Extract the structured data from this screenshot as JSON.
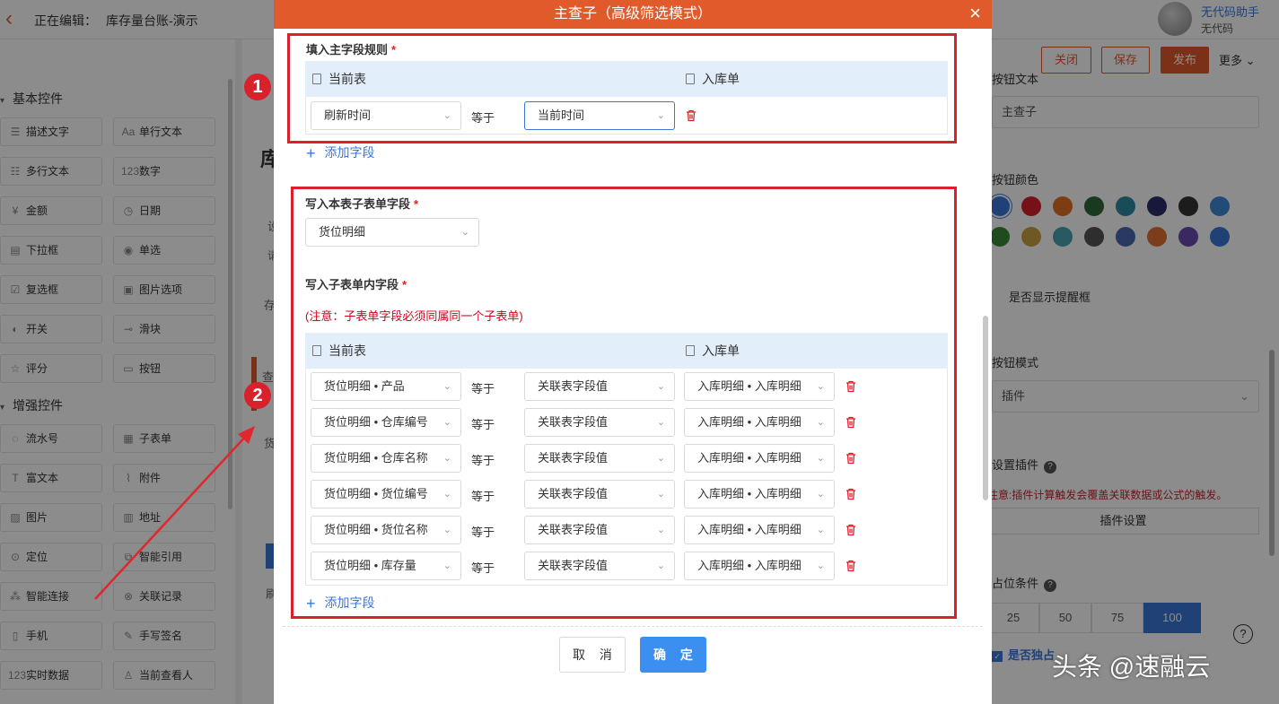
{
  "topbar": {
    "editing_label": "正在编辑：",
    "doc_name": "库存量台账-演示",
    "user_name": "无代码助手",
    "user_sub": "无代码"
  },
  "left_panel": {
    "basic_group": "基本控件",
    "enhanced_group": "增强控件",
    "basic_controls": [
      {
        "label": "描述文字",
        "icon": "text-lines-icon"
      },
      {
        "label": "单行文本",
        "icon": "font-aa-icon"
      },
      {
        "label": "多行文本",
        "icon": "multiline-icon"
      },
      {
        "label": "数字",
        "icon": "number-123-icon"
      },
      {
        "label": "金额",
        "icon": "money-icon"
      },
      {
        "label": "日期",
        "icon": "clock-icon"
      },
      {
        "label": "下拉框",
        "icon": "dropdown-icon"
      },
      {
        "label": "单选",
        "icon": "radio-icon"
      },
      {
        "label": "复选框",
        "icon": "checkbox-icon"
      },
      {
        "label": "图片选项",
        "icon": "image-option-icon"
      },
      {
        "label": "开关",
        "icon": "toggle-icon"
      },
      {
        "label": "滑块",
        "icon": "slider-icon"
      },
      {
        "label": "评分",
        "icon": "star-icon"
      },
      {
        "label": "按钮",
        "icon": "button-icon"
      }
    ],
    "enhanced_controls": [
      {
        "label": "流水号",
        "icon": "serial-icon"
      },
      {
        "label": "子表单",
        "icon": "subform-icon"
      },
      {
        "label": "富文本",
        "icon": "richtext-icon"
      },
      {
        "label": "附件",
        "icon": "paperclip-icon"
      },
      {
        "label": "图片",
        "icon": "image-icon"
      },
      {
        "label": "地址",
        "icon": "map-icon"
      },
      {
        "label": "定位",
        "icon": "location-pin-icon"
      },
      {
        "label": "智能引用",
        "icon": "smart-ref-icon"
      },
      {
        "label": "智能连接",
        "icon": "connect-icon"
      },
      {
        "label": "关联记录",
        "icon": "link-record-icon"
      },
      {
        "label": "手机",
        "icon": "phone-icon"
      },
      {
        "label": "手写签名",
        "icon": "signature-icon"
      },
      {
        "label": "实时数据",
        "icon": "realtime-icon"
      },
      {
        "label": "当前查看人",
        "icon": "viewer-icon"
      }
    ]
  },
  "canvas": {
    "title_char": "库",
    "frag1": "设",
    "frag2": "请",
    "frag3": "存",
    "frag4": "查",
    "frag5": "货",
    "frag6": "刷"
  },
  "right_panel": {
    "btn_close": "关闭",
    "btn_save": "保存",
    "btn_publish": "发布",
    "more": "更多",
    "button_text_label": "按钮文本",
    "button_text_value": "主查子",
    "button_color_label": "按钮颜色",
    "swatch_colors": [
      "#3b77d8",
      "#d8212b",
      "#e07020",
      "#2e6b3a",
      "#2a8aa0",
      "#2c2c6a",
      "#333333",
      "#3b8ad8",
      "#3a8a3a",
      "#c8a040",
      "#4aa0b0",
      "#555555",
      "#4a6ab0",
      "#e07030",
      "#6a4ab0",
      "#3b77d8"
    ],
    "show_reminder": "是否显示提醒框",
    "button_mode_label": "按钮模式",
    "button_mode_value": "插件",
    "plugin_label": "设置插件",
    "plugin_note": "注意:插件计算触发会覆盖关联数据或公式的触发。",
    "plugin_btn": "插件设置",
    "width_label": "占位条件",
    "pct_options": [
      "25",
      "50",
      "75",
      "100"
    ],
    "pct_active": "100",
    "independent": "是否独占",
    "help": "?"
  },
  "dialog": {
    "title": "主查子（高级筛选模式）",
    "section1": {
      "title": "填入主字段规则",
      "col_current": "当前表",
      "col_target": "入库单",
      "row": {
        "left": "刷新时间",
        "op": "等于",
        "right": "当前时间"
      },
      "add": "添加字段"
    },
    "section2": {
      "subform_title": "写入本表子表单字段",
      "subform_value": "货位明细",
      "inner_title": "写入子表单内字段",
      "notice": "(注意：子表单字段必须同属同一个子表单)",
      "col_current": "当前表",
      "col_target": "入库单",
      "rows": [
        {
          "left": "货位明细 • 产品",
          "op": "等于",
          "mid": "关联表字段值",
          "right": "入库明细 • 入库明细"
        },
        {
          "left": "货位明细 • 仓库编号",
          "op": "等于",
          "mid": "关联表字段值",
          "right": "入库明细 • 入库明细"
        },
        {
          "left": "货位明细 • 仓库名称",
          "op": "等于",
          "mid": "关联表字段值",
          "right": "入库明细 • 入库明细"
        },
        {
          "left": "货位明细 • 货位编号",
          "op": "等于",
          "mid": "关联表字段值",
          "right": "入库明细 • 入库明细"
        },
        {
          "left": "货位明细 • 货位名称",
          "op": "等于",
          "mid": "关联表字段值",
          "right": "入库明细 • 入库明细"
        },
        {
          "left": "货位明细 • 库存量",
          "op": "等于",
          "mid": "关联表字段值",
          "right": "入库明细 • 入库明细"
        }
      ],
      "add": "添加字段"
    },
    "cancel": "取 消",
    "confirm": "确 定"
  },
  "annotations": {
    "badge1": "1",
    "badge2": "2",
    "watermark": "头条 @速融云",
    "frame_color": "#d8212b"
  }
}
